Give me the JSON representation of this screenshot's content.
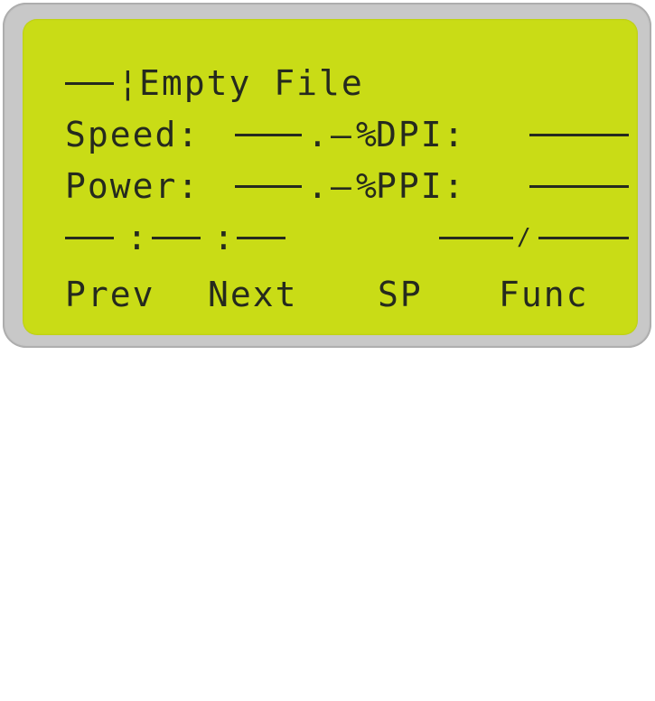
{
  "file_row": {
    "prefix_sep": "¦",
    "file_name": "Empty File"
  },
  "speed_row": {
    "label": "Speed:",
    "decimal_point": ".",
    "decimal_dash": "–",
    "unit": "%",
    "right_label": "DPI:"
  },
  "power_row": {
    "label": "Power:",
    "decimal_point": ".",
    "decimal_dash": "–",
    "unit": "%",
    "right_label": "PPI:"
  },
  "time_row": {
    "sep1": ":",
    "sep2": ":",
    "count_sep": "/"
  },
  "softkeys": {
    "prev": "Prev",
    "next": "Next",
    "sp": "SP",
    "func": "Func"
  },
  "colors": {
    "lcd_background": "#c9dc16",
    "lcd_text": "#252a1e",
    "bezel": "#c8c8c8"
  }
}
